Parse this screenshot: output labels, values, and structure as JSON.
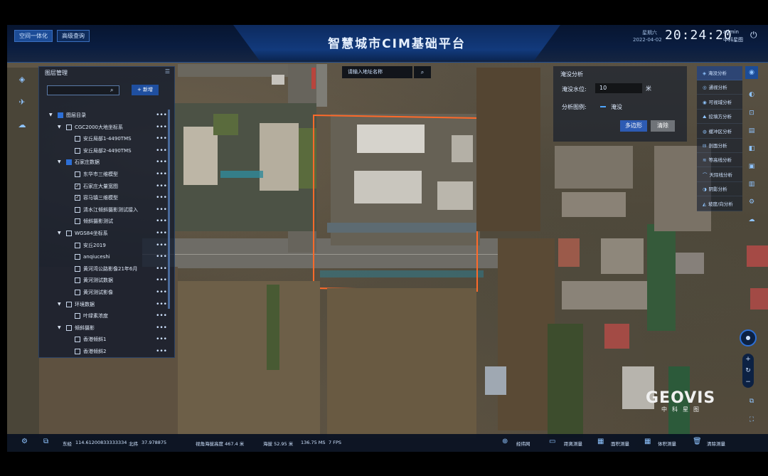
{
  "header": {
    "title": "智慧城市CIM基础平台",
    "mode_button": "空间一体化",
    "query_button": "高级查询",
    "weekday": "星期六",
    "date": "2022-04-02",
    "time": "20:24:20",
    "user_name": "admin",
    "user_org": "中科星图"
  },
  "layer_panel": {
    "title": "图层管理",
    "add_button": "+ 新增",
    "search_placeholder": "",
    "tree": [
      {
        "label": "图层目录",
        "level": 0,
        "checked": "partial",
        "expanded": true
      },
      {
        "label": "CGC2000大地坐标系",
        "level": 1,
        "checked": false,
        "expanded": true
      },
      {
        "label": "安丘局部1-4490TMS",
        "level": 2,
        "checked": false
      },
      {
        "label": "安丘局部2-4490TMS",
        "level": 2,
        "checked": false
      },
      {
        "label": "石家庄数据",
        "level": 1,
        "checked": "partial",
        "expanded": true
      },
      {
        "label": "东华市三维模型",
        "level": 2,
        "checked": false
      },
      {
        "label": "石家庄大量宽图",
        "level": 2,
        "checked": true
      },
      {
        "label": "容马镇三维模型",
        "level": 2,
        "checked": true
      },
      {
        "label": "清水江倾斜摄影测试接入",
        "level": 2,
        "checked": false
      },
      {
        "label": "倾斜摄影测试",
        "level": 2,
        "checked": false
      },
      {
        "label": "WGS84坐标系",
        "level": 1,
        "checked": false,
        "expanded": true
      },
      {
        "label": "安丘2019",
        "level": 2,
        "checked": false
      },
      {
        "label": "anqiuceshi",
        "level": 2,
        "checked": false
      },
      {
        "label": "黄河湾公路影像21年6月",
        "level": 2,
        "checked": false
      },
      {
        "label": "黄河测试数据",
        "level": 2,
        "checked": false
      },
      {
        "label": "黄河测试影像",
        "level": 2,
        "checked": false
      },
      {
        "label": "环境数据",
        "level": 1,
        "checked": false,
        "expanded": true
      },
      {
        "label": "叶绿素浓度",
        "level": 2,
        "checked": false
      },
      {
        "label": "倾斜摄影",
        "level": 1,
        "checked": false,
        "expanded": true
      },
      {
        "label": "香港倾斜1",
        "level": 2,
        "checked": false
      },
      {
        "label": "香港倾斜2",
        "level": 2,
        "checked": false
      }
    ]
  },
  "address_search": {
    "placeholder": "请输入地址名称"
  },
  "flood_panel": {
    "title": "淹没分析",
    "water_level_label": "淹没水位:",
    "water_level_value": "10",
    "unit": "米",
    "legend_label": "分析图例:",
    "legend_item": "淹没",
    "legend_color": "#4fa6ff",
    "polygon_button": "多边形",
    "clear_button": "清除"
  },
  "analysis_menu": [
    {
      "label": "淹没分析",
      "icon": "flood-icon"
    },
    {
      "label": "通视分析",
      "icon": "sight-icon"
    },
    {
      "label": "可视域分析",
      "icon": "viewshed-icon"
    },
    {
      "label": "挖填方分析",
      "icon": "cutfill-icon"
    },
    {
      "label": "缓冲区分析",
      "icon": "buffer-icon"
    },
    {
      "label": "剖面分析",
      "icon": "profile-icon"
    },
    {
      "label": "等高线分析",
      "icon": "contour-icon"
    },
    {
      "label": "天际线分析",
      "icon": "skyline-icon"
    },
    {
      "label": "阴影分析",
      "icon": "shadow-icon"
    },
    {
      "label": "坡度/向分析",
      "icon": "slope-icon"
    }
  ],
  "status_bar": {
    "lon_label": "东经",
    "lon": "114.61200833333334",
    "lat_label": "北纬",
    "lat": "37.978875",
    "view_height": "视角海拔高度 467.4 米",
    "altitude": "海拔 52.95 米",
    "ms": "136.75 MS",
    "fps": "7 FPS",
    "graticule": "经纬网",
    "distance": "距离测量",
    "area": "面积测量",
    "volume": "体积测量",
    "clear": "清除测量"
  },
  "logo": {
    "text": "GEOVIS",
    "sub": "中科星图"
  },
  "colors": {
    "accent": "#2d6fd6",
    "header_bg": "#0a1d40",
    "boundary": "#ff6a2a"
  }
}
